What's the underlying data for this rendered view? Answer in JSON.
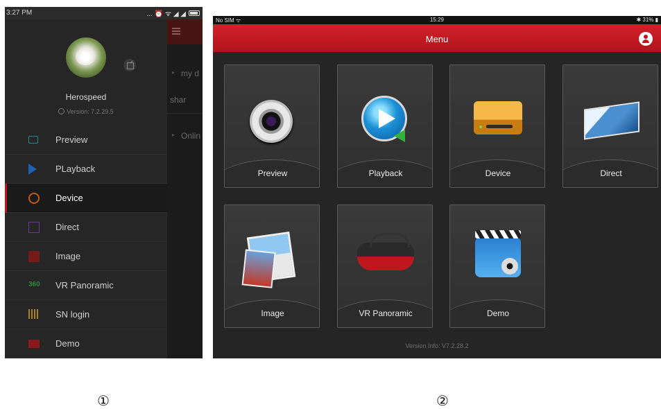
{
  "phone": {
    "status_time": "3:27 PM",
    "status_icons": "... ⏰ ᯤ ◢ ◢",
    "username": "Herospeed",
    "version": "Version: 7.2.29.5",
    "menu": [
      {
        "label": "Preview",
        "icon": "camera-icon",
        "color": "#1c8c8c"
      },
      {
        "label": "PLayback",
        "icon": "play-icon",
        "color": "#2060b0"
      },
      {
        "label": "Device",
        "icon": "gear-icon",
        "color": "#c05a10",
        "active": true
      },
      {
        "label": "Direct",
        "icon": "direct-icon",
        "color": "#6b3a9a"
      },
      {
        "label": "Image",
        "icon": "image-icon",
        "color": "#8a1818"
      },
      {
        "label": "VR Panoramic",
        "icon": "vr-360-icon",
        "color": "#2c8a3a",
        "glyph": "360"
      },
      {
        "label": "SN login",
        "icon": "barcode-icon",
        "color": "#a8831b"
      },
      {
        "label": "Demo",
        "icon": "demo-icon",
        "color": "#8a1818"
      }
    ],
    "background_list": [
      "my d",
      "shar",
      "Onlin"
    ]
  },
  "tablet": {
    "status_left": "No SIM ᯤ",
    "status_time": "15:29",
    "status_right": "✱ 31% ▮",
    "title": "Menu",
    "tiles": [
      {
        "label": "Preview",
        "icon": "camera-lens-icon"
      },
      {
        "label": "Playback",
        "icon": "playback-icon"
      },
      {
        "label": "Device",
        "icon": "hard-drive-icon"
      },
      {
        "label": "Direct",
        "icon": "direct-link-icon"
      },
      {
        "label": "Image",
        "icon": "photos-icon"
      },
      {
        "label": "VR Panoramic",
        "icon": "vr-headset-icon"
      },
      {
        "label": "Demo",
        "icon": "clapperboard-icon"
      }
    ],
    "version_info": "Version Info: V7.2.28.2"
  },
  "captions": [
    "①",
    "②"
  ],
  "colors": {
    "accent": "#c1121f",
    "header_red": "#d3212a",
    "panel_dark": "#262626"
  }
}
